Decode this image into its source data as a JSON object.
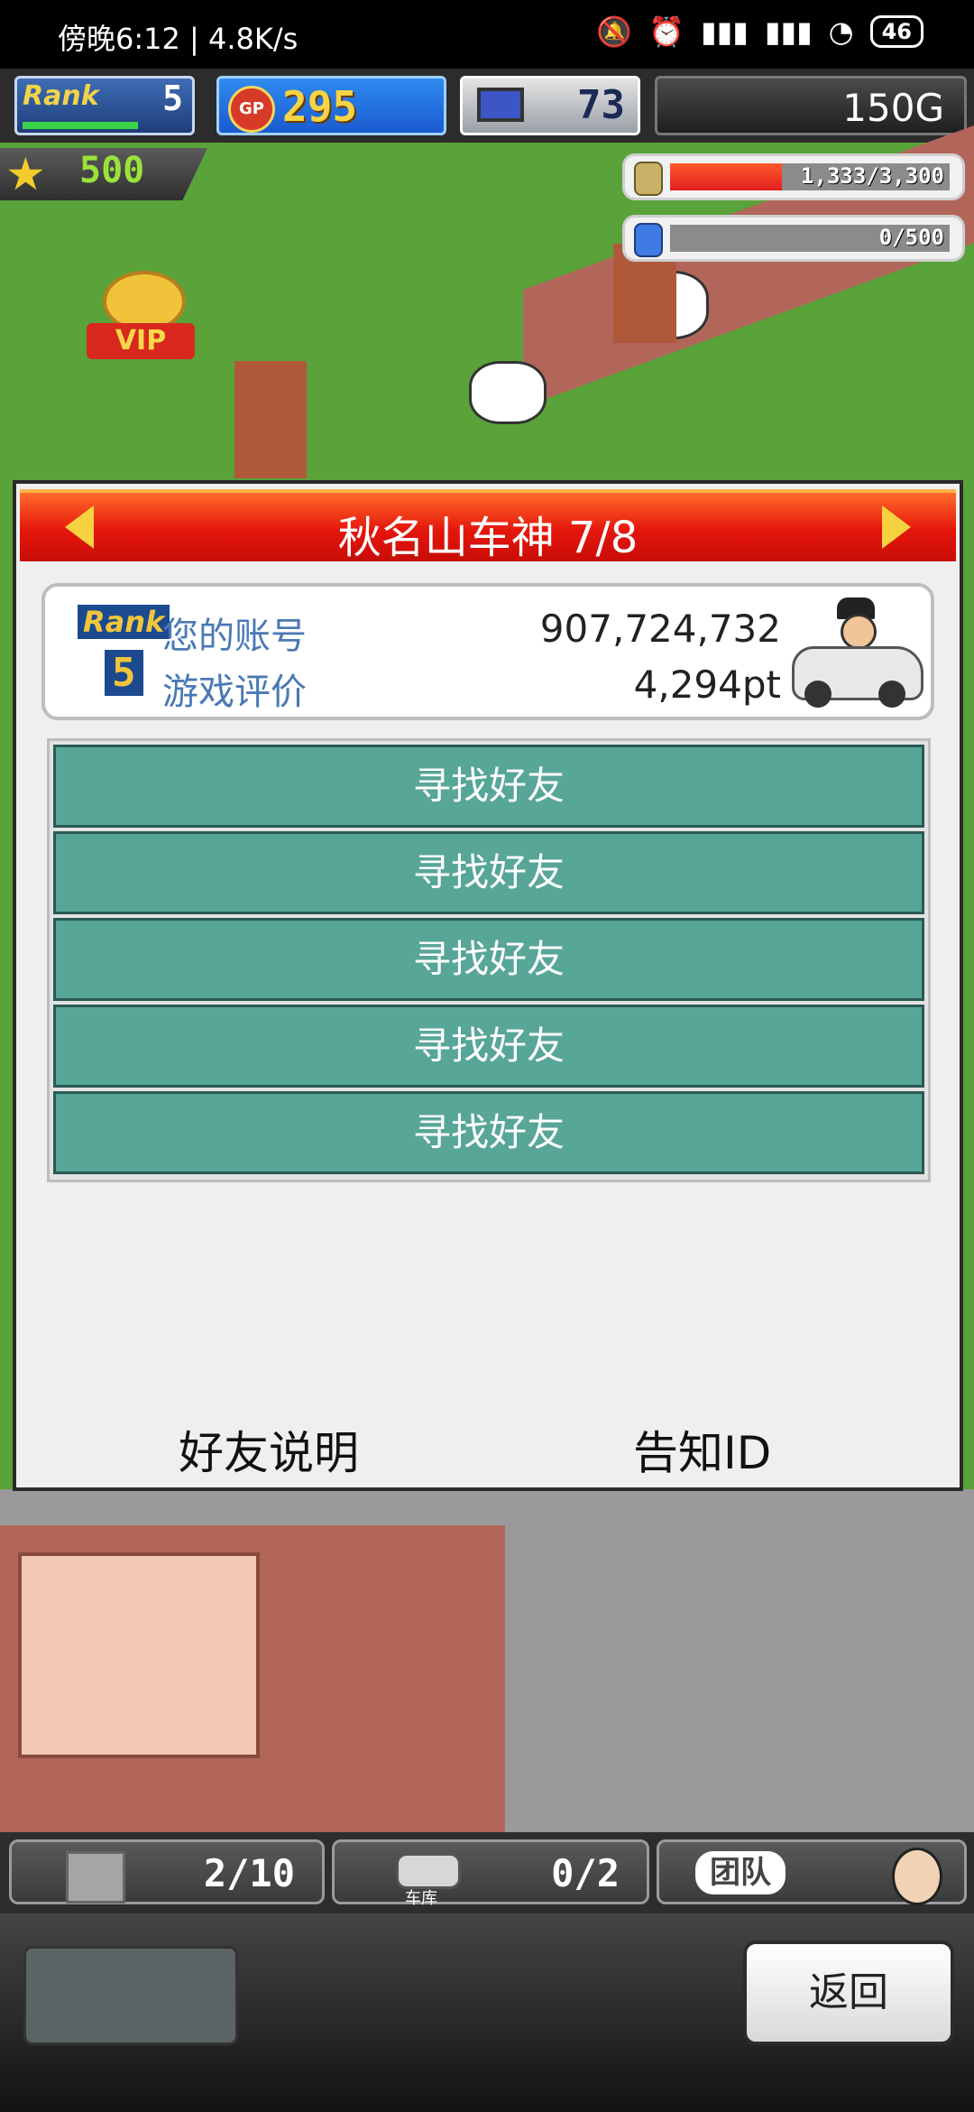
{
  "status_bar": {
    "time_speed": "傍晚6:12 | 4.8K/s",
    "battery": "46",
    "icons": [
      "mute-icon",
      "alarm-icon",
      "hd-signal-icon",
      "r-signal-icon",
      "wifi-icon",
      "battery-icon"
    ]
  },
  "hud": {
    "rank_label": "Rank",
    "rank_value": "5",
    "gp_label": "GP",
    "gp_value": "295",
    "pc_value": "73",
    "money": "150G",
    "stars": "500",
    "coin_meter": {
      "text": "1,333/3,300",
      "fill": 0.4
    },
    "fuel_meter": {
      "text": "0/500",
      "fill": 0
    }
  },
  "scene": {
    "vip_label": "VIP"
  },
  "dialog": {
    "title": "秋名山车神 7/8",
    "rank_label": "Rank",
    "rank_value": "5",
    "account_label": "您的账号",
    "account_value": "907,724,732",
    "rating_label": "游戏评价",
    "rating_value": "4,294pt",
    "find_friend_buttons": [
      "寻找好友",
      "寻找好友",
      "寻找好友",
      "寻找好友",
      "寻找好友"
    ],
    "friend_help": "好友说明",
    "tell_id": "告知ID"
  },
  "bottom": {
    "slot1_count": "2/10",
    "slot2_count": "0/2",
    "garage_caption": "车库",
    "team_label": "团队",
    "back_label": "返回"
  },
  "colors": {
    "header_red": "#e5160c",
    "button_teal": "#57a697",
    "label_blue": "#4a79b5"
  }
}
